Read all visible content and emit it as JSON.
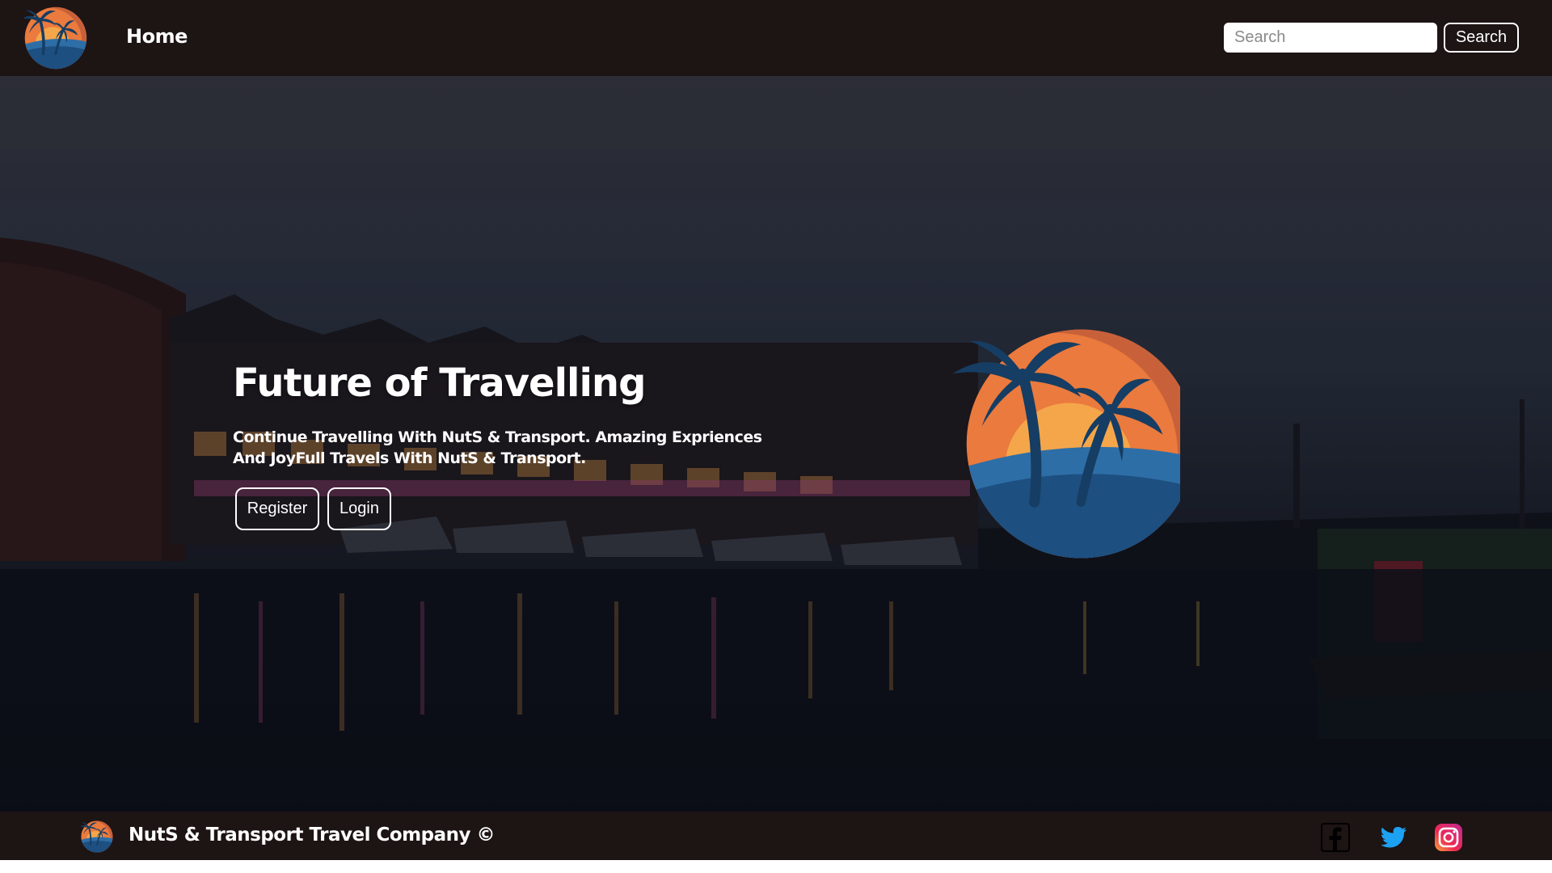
{
  "navbar": {
    "logo_icon": "palm-island-logo-icon",
    "home_label": "Home",
    "search_placeholder": "Search",
    "search_button_label": "Search"
  },
  "hero": {
    "title": "Future of Travelling",
    "description_line1": "Continue Travelling With NutS & Transport. Amazing Expriences",
    "description_line2": "And JoyFull Travels With NutS & Transport.",
    "register_label": "Register",
    "login_label": "Login",
    "logo_icon": "palm-island-logo-icon"
  },
  "footer": {
    "logo_icon": "palm-island-logo-icon",
    "company_text": "NutS & Transport Travel Company ©",
    "social_icons": [
      "facebook-icon",
      "twitter-icon",
      "instagram-icon"
    ]
  },
  "colors": {
    "nav_bg": "#1d1414",
    "logo_orange": "#e8703a",
    "logo_blue": "#1f4d7a",
    "twitter_blue": "#1da1f2"
  }
}
